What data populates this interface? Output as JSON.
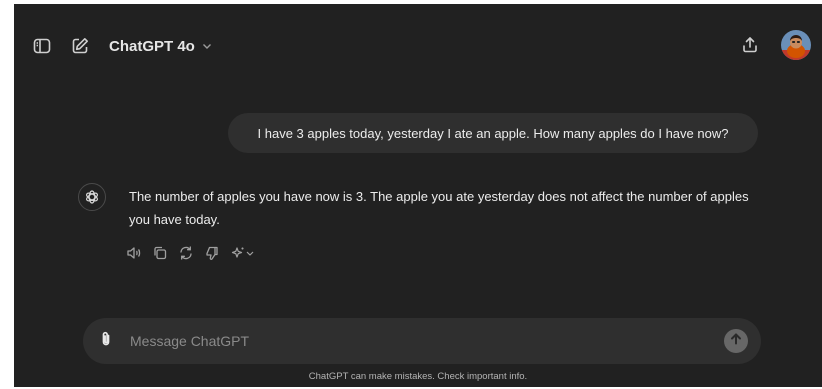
{
  "header": {
    "model_label": "ChatGPT 4o",
    "icons": {
      "sidebar": "sidebar-toggle-icon",
      "new_chat": "new-chat-icon",
      "model_dropdown": "chevron-down-icon",
      "share": "share-icon"
    }
  },
  "conversation": {
    "user_message": "I have 3 apples today, yesterday I ate an apple. How many apples do I have now?",
    "assistant_message": "The number of apples you have now is 3. The apple you ate yesterday does not affect the number of apples you have today.",
    "assistant_icon": "openai-logo-icon",
    "actions": [
      "read-aloud-icon",
      "copy-icon",
      "regenerate-icon",
      "thumbs-down-icon",
      "sparkle-model-icon"
    ]
  },
  "composer": {
    "placeholder": "Message ChatGPT",
    "value": "",
    "attach_icon": "paperclip-icon",
    "send_icon": "arrow-up-icon"
  },
  "footer": {
    "disclaimer": "ChatGPT can make mistakes. Check important info."
  },
  "colors": {
    "background": "#212121",
    "bubble": "#2f2f2f",
    "text": "#ececec",
    "muted": "#b4b4b4"
  }
}
